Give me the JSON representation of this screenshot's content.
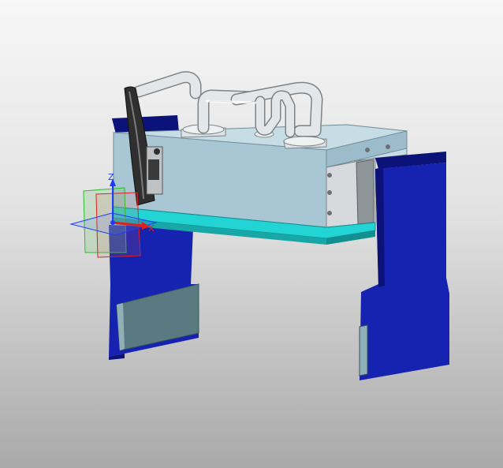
{
  "viewport": {
    "background_top": "#f7f7f7",
    "background_bottom": "#a9a9a9"
  },
  "model": {
    "colors": {
      "body": "#a8c6d4",
      "body_top": "#c7dde6",
      "body_front": "#9dbccb",
      "base_plate": "#23d4d4",
      "base_plate_dark": "#17a7a7",
      "side_blocks": "#1622b0",
      "side_blocks_dark": "#0b1378",
      "pads": "#5a7a82",
      "tubes": "#dfe3e5",
      "handle": "#3a3a3a",
      "gripper": "#bfc3c5"
    }
  },
  "triad": {
    "x_label": "X",
    "z_label": "Z",
    "x_color": "#e02020",
    "y_color": "#2bbd2b",
    "z_color": "#1a3cff"
  }
}
